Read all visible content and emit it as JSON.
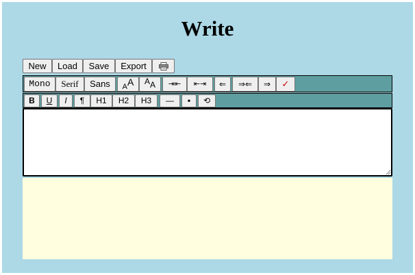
{
  "app": {
    "title": "Write"
  },
  "menu": {
    "new": "New",
    "load": "Load",
    "save": "Save",
    "export": "Export",
    "print_icon": "printer-icon"
  },
  "toolbar1": {
    "mono": "Mono",
    "serif": "Serif",
    "sans": "Sans",
    "font_larger": "AA",
    "font_smaller": "AA",
    "width_narrow": "⇥⇤",
    "width_wide": "⇤⇥",
    "align_left": "⇐",
    "align_center": "⇒⇐",
    "align_right": "⇒",
    "spellcheck": "✓",
    "spellcheck_color": "#cc0000"
  },
  "toolbar2": {
    "bold": "B",
    "underline": "U",
    "italic": "I",
    "paragraph": "¶",
    "h1": "H1",
    "h2": "H2",
    "h3": "H3",
    "rule": "—",
    "bullet": "•",
    "undo": "⟲"
  },
  "editor": {
    "value": ""
  },
  "colors": {
    "background": "#add8e6",
    "toolbar": "#5f9ea0",
    "preview": "#ffffe0"
  }
}
